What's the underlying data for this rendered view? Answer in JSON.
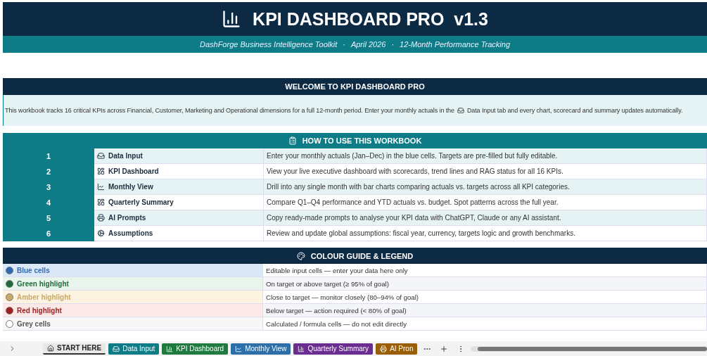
{
  "header": {
    "title": "KPI DASHBOARD PRO  v1.3",
    "subtitle": [
      "DashForge Business Intelligence Toolkit",
      "·",
      "April 2026",
      "·",
      "12-Month Performance Tracking"
    ]
  },
  "welcome": {
    "title": "WELCOME TO KPI DASHBOARD PRO",
    "text_before": "This workbook tracks 16 critical KPIs across Financial, Customer, Marketing and Operational dimensions for a full 12-month period. Enter your monthly actuals in the",
    "text_after": "Data Input tab and every chart, scorecard and summary updates automatically."
  },
  "how_to": {
    "title": "HOW TO USE THIS WORKBOOK",
    "rows": [
      {
        "number": "1",
        "sheet": "Data Input",
        "description": "Enter your monthly actuals (Jan–Dec) in the blue cells. Targets are pre-filled but fully editable."
      },
      {
        "number": "2",
        "sheet": "KPI Dashboard",
        "description": "View your live executive dashboard with scorecards, trend lines and RAG status for all 16 KPIs."
      },
      {
        "number": "3",
        "sheet": "Monthly View",
        "description": "Drill into any single month with bar charts comparing actuals vs. targets across all KPI categories."
      },
      {
        "number": "4",
        "sheet": "Quarterly Summary",
        "description": "Compare Q1–Q4 performance and YTD actuals vs. budget. Spot patterns across the full year."
      },
      {
        "number": "5",
        "sheet": "AI Prompts",
        "description": "Copy ready-made prompts to analyse your KPI data with ChatGPT, Claude or any AI assistant."
      },
      {
        "number": "6",
        "sheet": "Assumptions",
        "description": "Review and update global assumptions: fiscal year, currency, targets logic and growth benchmarks."
      }
    ]
  },
  "legend": {
    "title": "COLOUR GUIDE & LEGEND",
    "rows": [
      {
        "label": "Blue cells",
        "color": "#2e6bb5",
        "description": "Editable input cells — enter your data here only"
      },
      {
        "label": "Green highlight",
        "color": "#1e6b3a",
        "description": "On target or above target (≥ 95% of goal)"
      },
      {
        "label": "Amber highlight",
        "color": "#c9a86a",
        "description": "Close to target — monitor closely (80–94% of goal)"
      },
      {
        "label": "Red highlight",
        "color": "#a31f1f",
        "description": "Below target — action required (< 80% of goal)"
      },
      {
        "label": "Grey cells",
        "color": "#ffffff",
        "description": "Calculated / formula cells — do not edit directly"
      }
    ]
  },
  "sheet_tabs": [
    {
      "label": "START HERE",
      "color": "#e8e8e8",
      "selected": true
    },
    {
      "label": "Data Input",
      "color": "#0e7c86",
      "selected": false
    },
    {
      "label": "KPI Dashboard",
      "color": "#1f7a3f",
      "selected": false
    },
    {
      "label": "Monthly View",
      "color": "#2c6fa8",
      "selected": false
    },
    {
      "label": "Quarterly Summary",
      "color": "#6a2c91",
      "selected": false
    },
    {
      "label": "AI Pron",
      "color": "#9a5f06",
      "selected": false
    }
  ]
}
